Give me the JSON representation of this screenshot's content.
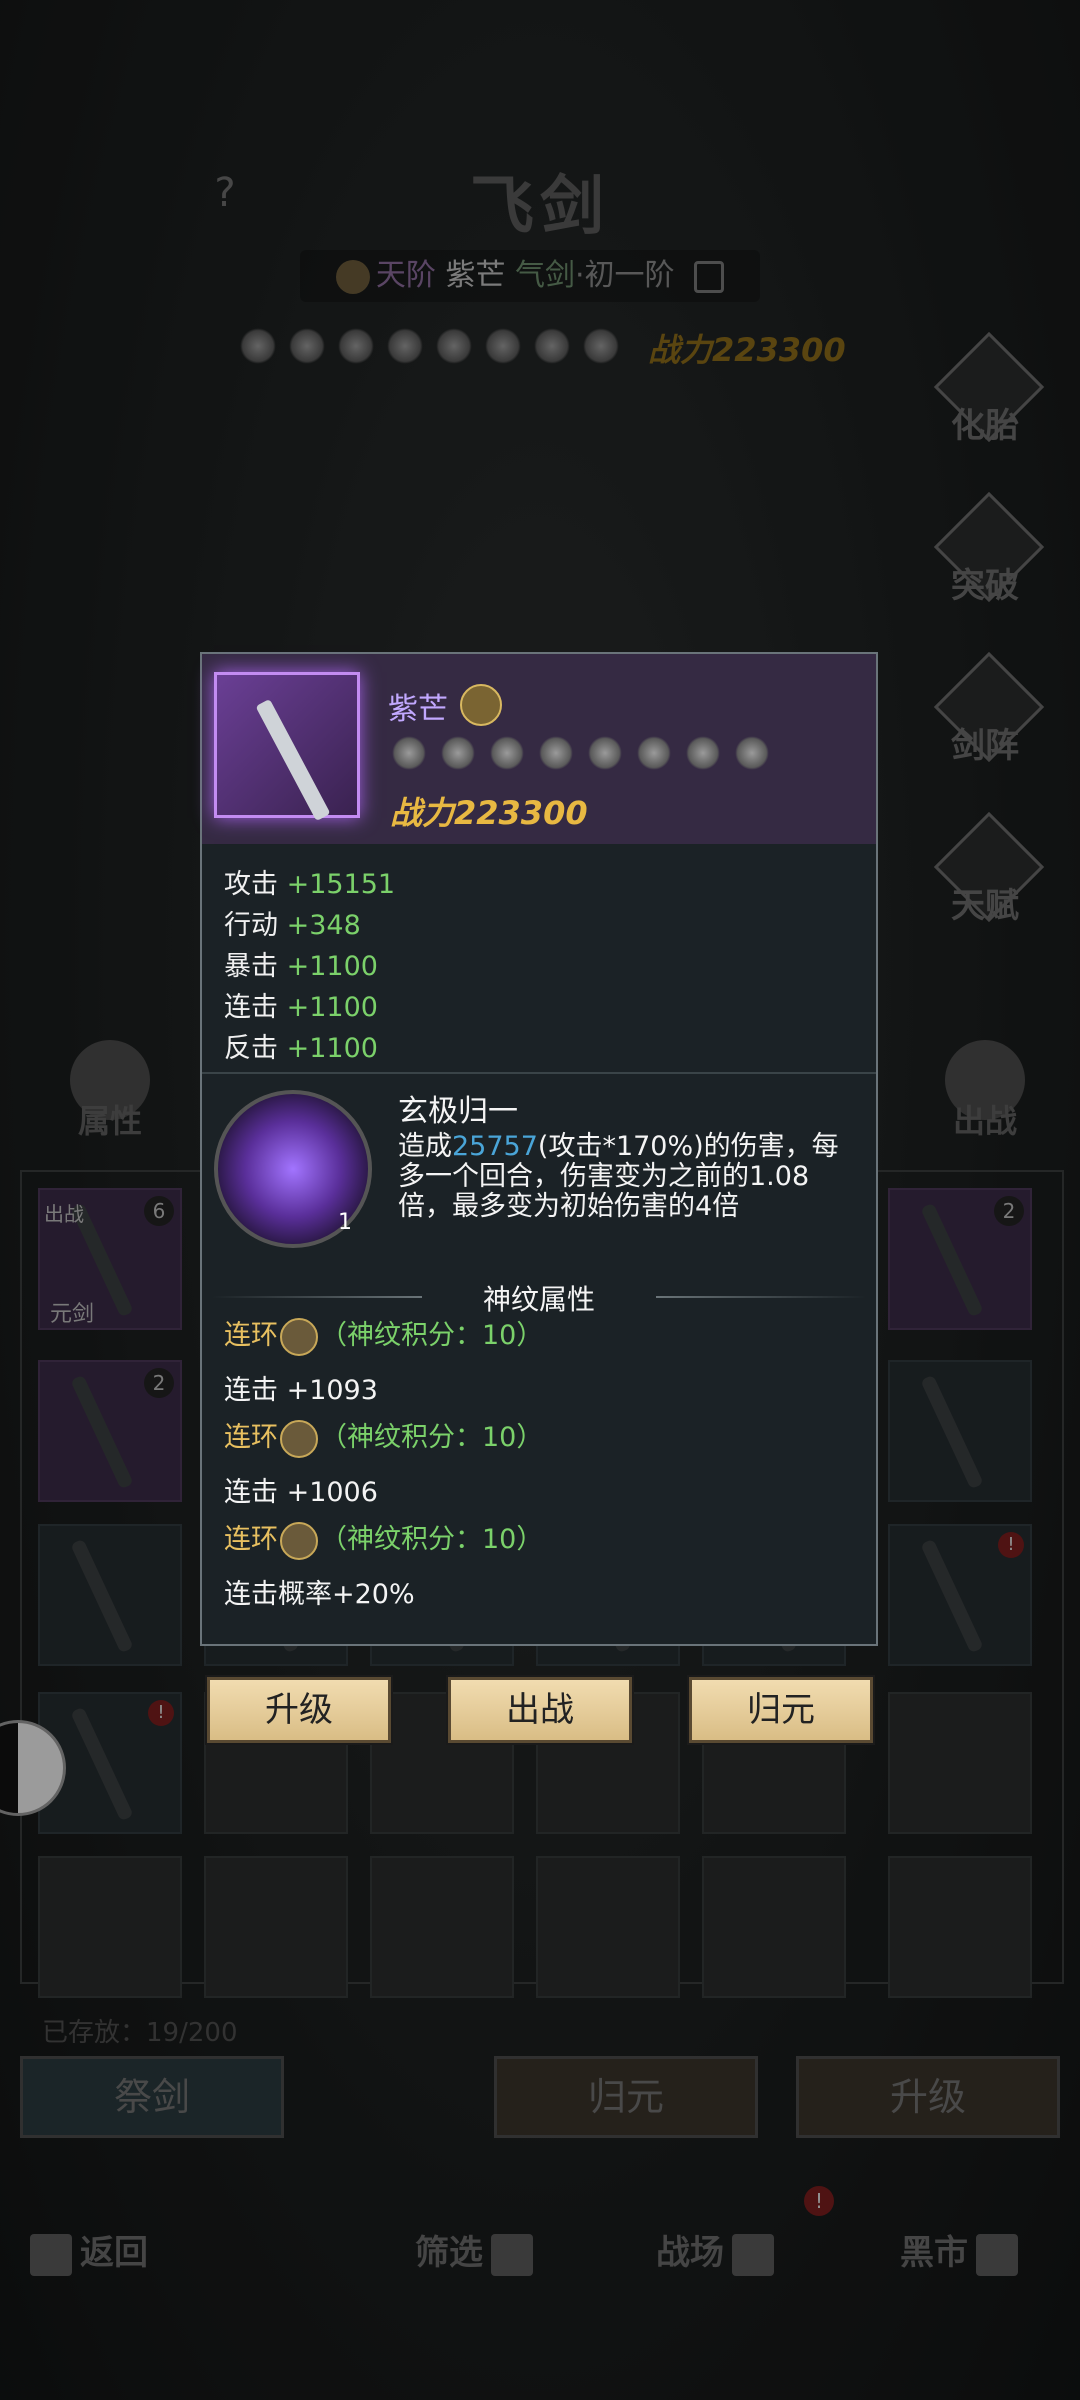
{
  "header": {
    "help": "?",
    "title": "飞剑",
    "subtitle": {
      "tier": "天阶",
      "name": "紫芒",
      "type": "气剑",
      "dot": "·",
      "stage": "初一阶"
    },
    "power": "战力223300"
  },
  "side_menu": [
    "化胎",
    "突破",
    "剑阵",
    "天赋"
  ],
  "left_tab": "属性",
  "right_tab": "出战",
  "grid_labels": {
    "cell1_tag": "出战",
    "cell1_lock": "元剑",
    "cell1_count": "6",
    "cell6_count": "2",
    "row2_count": "2",
    "alert": "!"
  },
  "stored": {
    "label": "已存放：",
    "value": "19/200"
  },
  "bottom_buttons": {
    "sacrifice": "祭剑",
    "return": "归元",
    "upgrade": "升级"
  },
  "nav": {
    "back": "返回",
    "filter": "筛选",
    "battle": "战场",
    "market": "黑市",
    "alert": "!"
  },
  "popup": {
    "item_name": "紫芒",
    "power": "战力223300",
    "attributes": [
      {
        "name": "攻击",
        "value": "+15151"
      },
      {
        "name": "行动",
        "value": "+348"
      },
      {
        "name": "暴击",
        "value": "+1100"
      },
      {
        "name": "连击",
        "value": "+1100"
      },
      {
        "name": "反击",
        "value": "+1100"
      }
    ],
    "skill": {
      "name": "玄极归一",
      "level": "1",
      "desc_pre": "造成",
      "desc_num": "25757",
      "desc_post": "(攻击*170%)的伤害，每多一个回合，伤害变为之前的1.08倍，最多变为初始伤害的4倍"
    },
    "section_title": "神纹属性",
    "runes": [
      {
        "name": "连环",
        "score": "（神纹积分：10）",
        "effect": "连击 +1093"
      },
      {
        "name": "连环",
        "score": "（神纹积分：10）",
        "effect": "连击 +1006"
      },
      {
        "name": "连环",
        "score": "（神纹积分：10）",
        "effect": "连击概率+20%"
      }
    ]
  },
  "actions": {
    "upgrade": "升级",
    "deploy": "出战",
    "return": "归元"
  }
}
